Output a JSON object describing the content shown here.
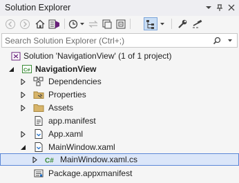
{
  "window": {
    "title": "Solution Explorer",
    "controls": [
      "chevron-down-icon",
      "pin-icon",
      "close-icon"
    ]
  },
  "toolbar": {
    "buttons": [
      "back-icon",
      "forward-icon",
      "home-icon",
      "switch-views-icon",
      "pending-changes-filter-icon",
      "sync-with-active-document-icon",
      "refresh-icon",
      "collapse-all-icon",
      "show-all-files-icon",
      "preview-selected-items-icon",
      "properties-icon",
      "settings-icon"
    ]
  },
  "search": {
    "placeholder": "Search Solution Explorer (Ctrl+;)"
  },
  "tree": {
    "solution": "Solution 'NavigationView' (1 of 1 project)",
    "project": "NavigationView",
    "items": [
      {
        "label": "Dependencies"
      },
      {
        "label": "Properties"
      },
      {
        "label": "Assets"
      },
      {
        "label": "app.manifest"
      },
      {
        "label": "App.xaml"
      },
      {
        "label": "MainWindow.xaml"
      },
      {
        "label": "MainWindow.xaml.cs"
      },
      {
        "label": "Package.appxmanifest"
      }
    ],
    "selected": "MainWindow.xaml.cs"
  },
  "colors": {
    "selection_bg": "#dbe6f9",
    "selection_border": "#5b87d6",
    "csharp_green": "#388a34",
    "folder_tan": "#d7b46a",
    "toolbar_active": "#c9def5"
  }
}
